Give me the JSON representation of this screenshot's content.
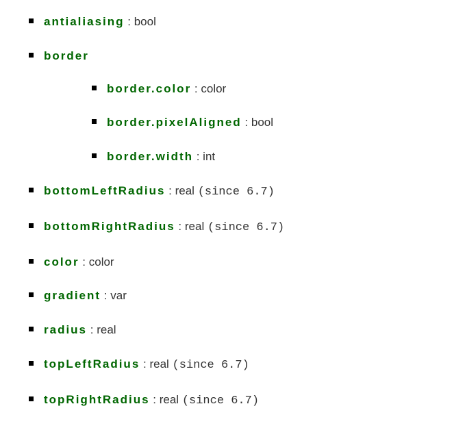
{
  "separator": " : ",
  "sinceNote": "(since 6.7)",
  "props": [
    {
      "name": "antialiasing",
      "type": "bool"
    },
    {
      "name": "border",
      "children": [
        {
          "name": "border.color",
          "type": "color"
        },
        {
          "name": "border.pixelAligned",
          "type": "bool"
        },
        {
          "name": "border.width",
          "type": "int"
        }
      ]
    },
    {
      "name": "bottomLeftRadius",
      "type": "real",
      "since": true
    },
    {
      "name": "bottomRightRadius",
      "type": "real",
      "since": true
    },
    {
      "name": "color",
      "type": "color"
    },
    {
      "name": "gradient",
      "type": "var"
    },
    {
      "name": "radius",
      "type": "real"
    },
    {
      "name": "topLeftRadius",
      "type": "real",
      "since": true
    },
    {
      "name": "topRightRadius",
      "type": "real",
      "since": true
    }
  ]
}
